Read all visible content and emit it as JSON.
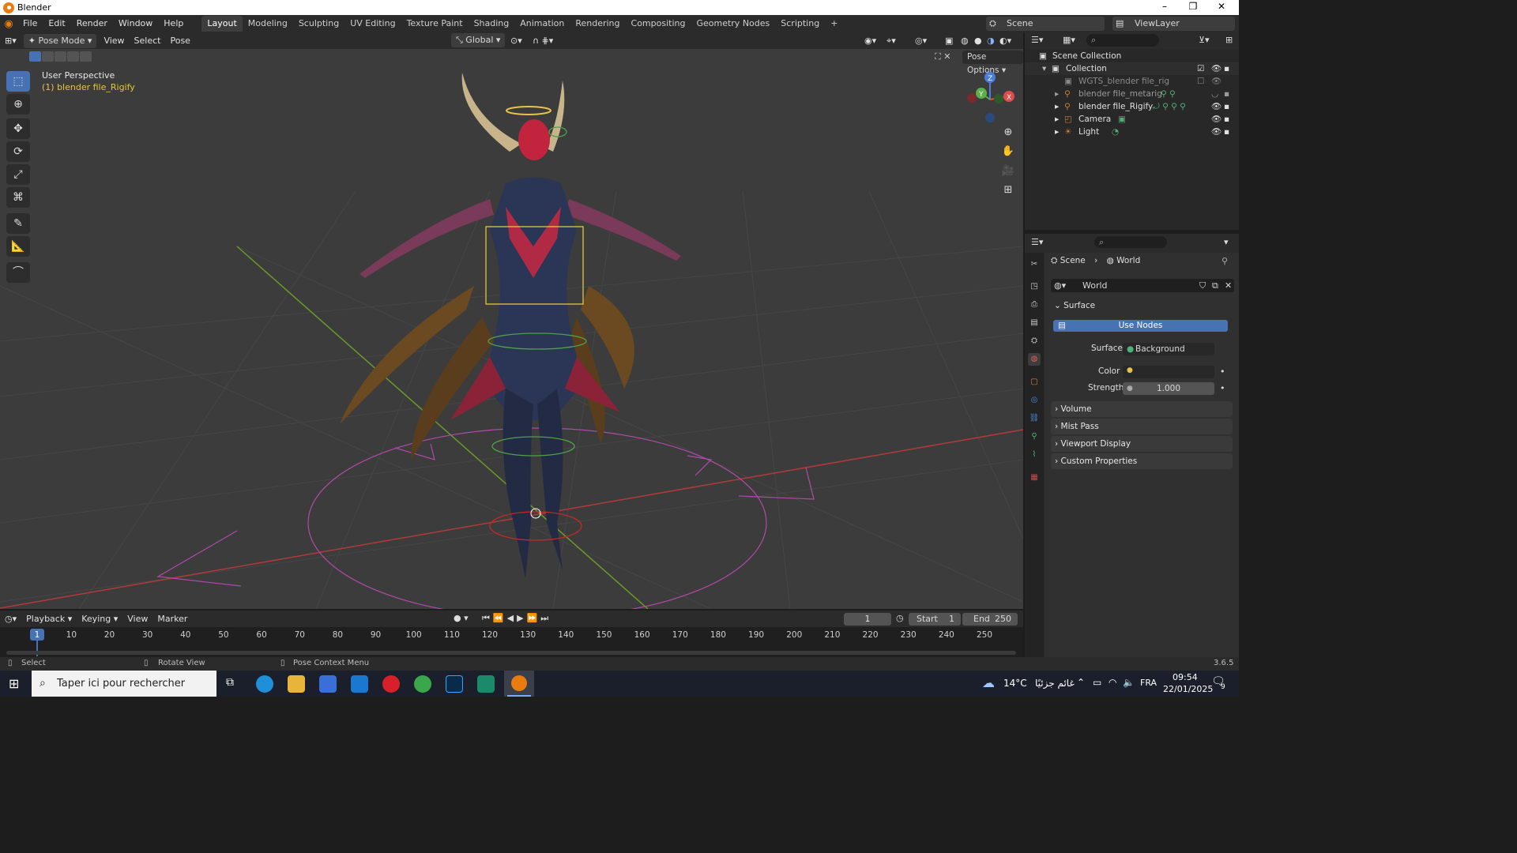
{
  "window": {
    "title": "Blender",
    "minimize": "–",
    "maximize": "❐",
    "close": "✕"
  },
  "menu": [
    "File",
    "Edit",
    "Render",
    "Window",
    "Help"
  ],
  "workspaces": [
    "Layout",
    "Modeling",
    "Sculpting",
    "UV Editing",
    "Texture Paint",
    "Shading",
    "Animation",
    "Rendering",
    "Compositing",
    "Geometry Nodes",
    "Scripting",
    "+"
  ],
  "active_workspace": "Layout",
  "scene_selector": {
    "label": "Scene"
  },
  "viewlayer_selector": {
    "label": "ViewLayer"
  },
  "viewport_header": {
    "mode": "Pose Mode",
    "menus": [
      "View",
      "Select",
      "Pose"
    ],
    "transform_orientation": "Global",
    "pose_options": "Pose Options"
  },
  "viewport": {
    "perspective": "User Perspective",
    "object_name": "(1) blender file_Rigify",
    "colors": {
      "bg": "#3c3c3c",
      "grid": "#474747",
      "x_axis": "#b33a3a",
      "y_axis": "#6a9a2a",
      "rig": "#b04aa8"
    }
  },
  "gizmo": {
    "x": "X",
    "y": "Y",
    "z": "Z"
  },
  "outliner": {
    "root": "Scene Collection",
    "items": [
      {
        "label": "Collection",
        "icon": "collection-icon"
      },
      {
        "label": "WGTS_blender file_rig",
        "icon": "collection-icon"
      },
      {
        "label": "blender file_metarig",
        "icon": "armature-icon"
      },
      {
        "label": "blender file_Rigify",
        "icon": "armature-icon"
      },
      {
        "label": "Camera",
        "icon": "camera-icon"
      },
      {
        "label": "Light",
        "icon": "light-icon"
      }
    ]
  },
  "properties": {
    "breadcrumb": {
      "scene": "Scene",
      "world": "World"
    },
    "datablock": "World",
    "surface_panel": "Surface",
    "use_nodes": "Use Nodes",
    "surface_label": "Surface",
    "surface_value": "Background",
    "color_label": "Color",
    "strength_label": "Strength",
    "strength_value": "1.000",
    "panels": [
      "Volume",
      "Mist Pass",
      "Viewport Display",
      "Custom Properties"
    ]
  },
  "timeline": {
    "menus": [
      "Playback",
      "Keying",
      "View",
      "Marker"
    ],
    "current_frame": "1",
    "start_label": "Start",
    "start": "1",
    "end_label": "End",
    "end": "250",
    "ticks": [
      "1",
      "10",
      "20",
      "30",
      "40",
      "50",
      "60",
      "70",
      "80",
      "90",
      "100",
      "110",
      "120",
      "130",
      "140",
      "150",
      "160",
      "170",
      "180",
      "190",
      "200",
      "210",
      "220",
      "230",
      "240",
      "250"
    ]
  },
  "statusbar": {
    "select": "Select",
    "rotate": "Rotate View",
    "context": "Pose Context Menu",
    "version": "3.6.5"
  },
  "taskbar": {
    "search_placeholder": "Taper ici pour rechercher",
    "weather": "14°C",
    "weather_text": "غائم جزئيًا",
    "language": "FRA",
    "time": "09:54",
    "date": "22/01/2025",
    "notifications": "9"
  }
}
